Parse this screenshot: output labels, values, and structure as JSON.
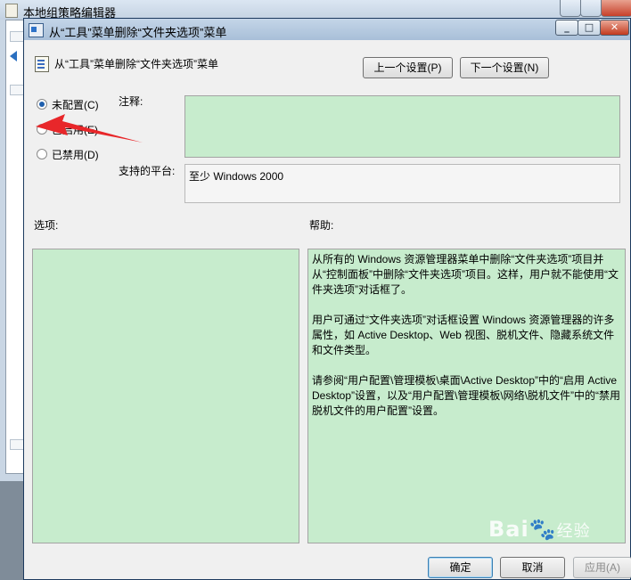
{
  "background_window": {
    "title": "本地组策略编辑器",
    "controls": [
      "minimize",
      "maximize",
      "close"
    ]
  },
  "dialog": {
    "title": "从“工具”菜单删除“文件夹选项”菜单",
    "header_title": "从“工具”菜单删除“文件夹选项”菜单",
    "buttons": {
      "prev": "上一个设置(P)",
      "next": "下一个设置(N)",
      "ok": "确定",
      "cancel": "取消",
      "apply": "应用(A)"
    },
    "radios": [
      {
        "label": "未配置(C)",
        "checked": true
      },
      {
        "label": "已启用(E)",
        "checked": false
      },
      {
        "label": "已禁用(D)",
        "checked": false
      }
    ],
    "comment_label": "注释:",
    "comment_value": "",
    "platform_label": "支持的平台:",
    "platform_value": "至少 Windows 2000",
    "options_label": "选项:",
    "help_label": "帮助:",
    "help_paragraphs": [
      "从所有的 Windows 资源管理器菜单中删除“文件夹选项”项目并从“控制面板”中删除“文件夹选项”项目。这样，用户就不能使用“文件夹选项”对话框了。",
      "用户可通过“文件夹选项”对话框设置 Windows 资源管理器的许多属性，如 Active Desktop、Web 视图、脱机文件、隐藏系统文件和文件类型。",
      "请参阅“用户配置\\管理模板\\桌面\\Active Desktop”中的“启用 Active Desktop”设置，以及“用户配置\\管理模板\\网络\\脱机文件”中的“禁用脱机文件的用户配置”设置。"
    ]
  },
  "watermark": {
    "text": "Bai",
    "suffix": "经验"
  },
  "colors": {
    "field_green": "#c7eccd",
    "annotation_red": "#e8272a",
    "title_blue": "#a8bfd8"
  }
}
